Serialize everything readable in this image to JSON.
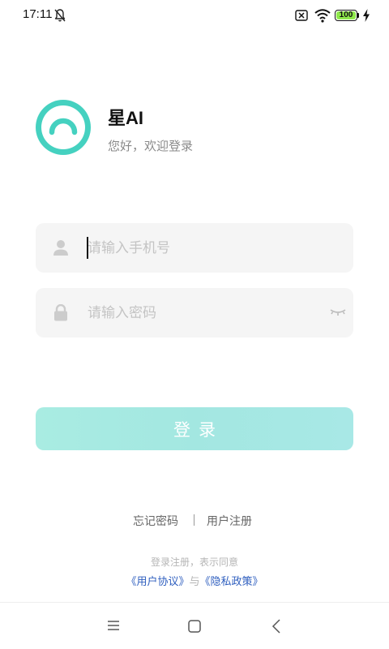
{
  "status_bar": {
    "time": "17:11",
    "battery_level": "100",
    "battery_fraction": 1.0,
    "icons": [
      "mute-bell-icon",
      "no-sim-icon",
      "wifi-icon",
      "battery-icon",
      "charging-bolt-icon"
    ]
  },
  "header": {
    "app_name": "星AI",
    "welcome": "您好，欢迎登录",
    "logo_icon": "arc-logo-icon",
    "brand_color": "#45d1c0"
  },
  "form": {
    "phone": {
      "value": "",
      "placeholder": "请输入手机号",
      "icon": "user-icon"
    },
    "password": {
      "value": "",
      "placeholder": "请输入密码",
      "icon": "lock-icon",
      "toggle_icon": "eye-closed-icon"
    },
    "login_label": "登录",
    "login_color": "#a6eae3"
  },
  "links": {
    "forgot": "忘记密码",
    "register": "用户注册"
  },
  "agreement": {
    "prefix": "登录注册，表示同意",
    "user_agreement": "《用户协议》",
    "connector": "与",
    "privacy_policy": "《隐私政策》",
    "link_color": "#2f5fbf"
  },
  "nav_bar": {
    "icons": [
      "menu-icon",
      "home-icon",
      "back-icon"
    ]
  }
}
